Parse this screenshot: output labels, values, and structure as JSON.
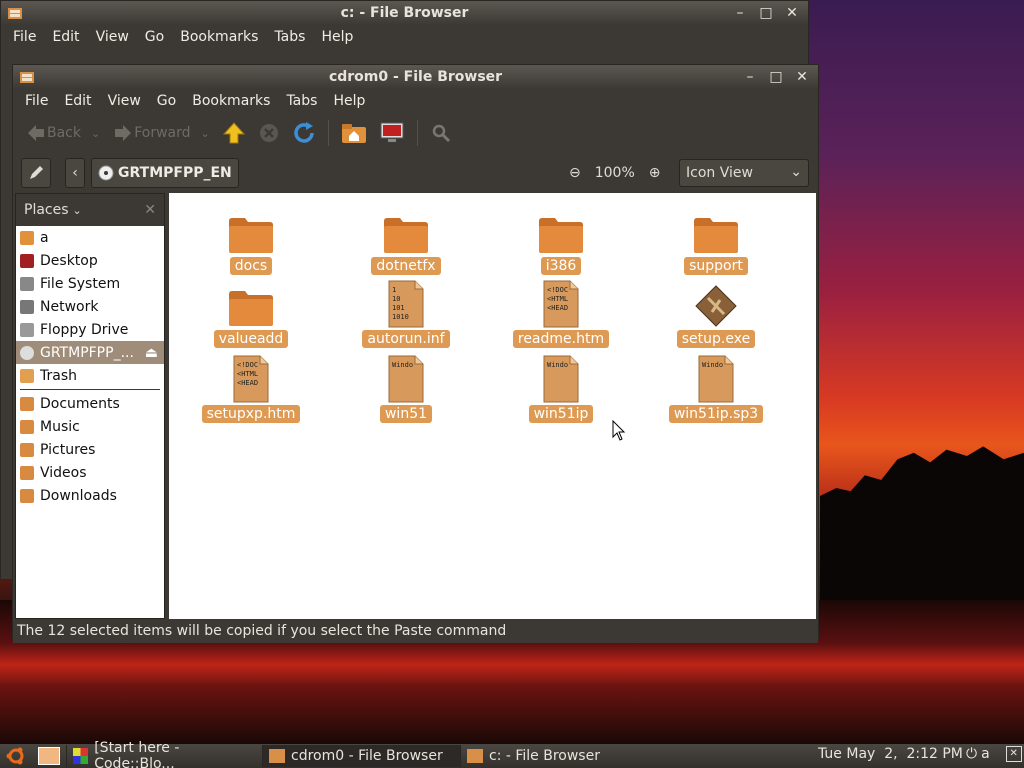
{
  "back_window": {
    "title": "c: - File Browser",
    "menu": [
      "File",
      "Edit",
      "View",
      "Go",
      "Bookmarks",
      "Tabs",
      "Help"
    ]
  },
  "window": {
    "title": "cdrom0 - File Browser",
    "menu": [
      "File",
      "Edit",
      "View",
      "Go",
      "Bookmarks",
      "Tabs",
      "Help"
    ],
    "toolbar": {
      "back": "Back",
      "forward": "Forward"
    },
    "location": {
      "crumb": "GRTMPFPP_EN",
      "zoom": "100%",
      "view_mode": "Icon View"
    },
    "sidebar": {
      "header": "Places",
      "items": [
        {
          "label": "a",
          "icon": "home-folder-icon"
        },
        {
          "label": "Desktop",
          "icon": "desktop-icon"
        },
        {
          "label": "File System",
          "icon": "drive-icon"
        },
        {
          "label": "Network",
          "icon": "network-icon"
        },
        {
          "label": "Floppy Drive",
          "icon": "floppy-icon"
        },
        {
          "label": "GRTMPFPP_...",
          "icon": "cdrom-icon",
          "selected": true
        },
        {
          "label": "Trash",
          "icon": "trash-icon"
        }
      ],
      "bookmarks": [
        {
          "label": "Documents",
          "icon": "folder-icon"
        },
        {
          "label": "Music",
          "icon": "folder-icon"
        },
        {
          "label": "Pictures",
          "icon": "folder-icon"
        },
        {
          "label": "Videos",
          "icon": "folder-icon"
        },
        {
          "label": "Downloads",
          "icon": "folder-icon"
        }
      ]
    },
    "files": [
      {
        "name": "docs",
        "type": "folder"
      },
      {
        "name": "dotnetfx",
        "type": "folder"
      },
      {
        "name": "i386",
        "type": "folder"
      },
      {
        "name": "support",
        "type": "folder"
      },
      {
        "name": "valueadd",
        "type": "folder"
      },
      {
        "name": "autorun.inf",
        "type": "text",
        "preview": [
          "1",
          "10",
          "101",
          "1010"
        ]
      },
      {
        "name": "readme.htm",
        "type": "html",
        "preview": [
          "<!DOC",
          "<HTML",
          "<HEAD"
        ]
      },
      {
        "name": "setup.exe",
        "type": "exe"
      },
      {
        "name": "setupxp.htm",
        "type": "html",
        "preview": [
          "<!DOC",
          "<HTML",
          "<HEAD"
        ]
      },
      {
        "name": "win51",
        "type": "text",
        "preview": [
          "Windo"
        ]
      },
      {
        "name": "win51ip",
        "type": "text",
        "preview": [
          "Windo"
        ]
      },
      {
        "name": "win51ip.sp3",
        "type": "text",
        "preview": [
          "Windo"
        ]
      }
    ],
    "status": "The 12 selected items will be copied if you select the Paste command"
  },
  "taskbar": {
    "tasks": [
      "[Start here - Code::Blo...",
      "cdrom0 - File Browser",
      "c: - File Browser"
    ],
    "clock": "Tue May  2,  2:12 PM",
    "user": "a"
  },
  "colors": {
    "accent": "#de9a52",
    "chrome": "#3c3935",
    "selection": "#a08d79"
  }
}
